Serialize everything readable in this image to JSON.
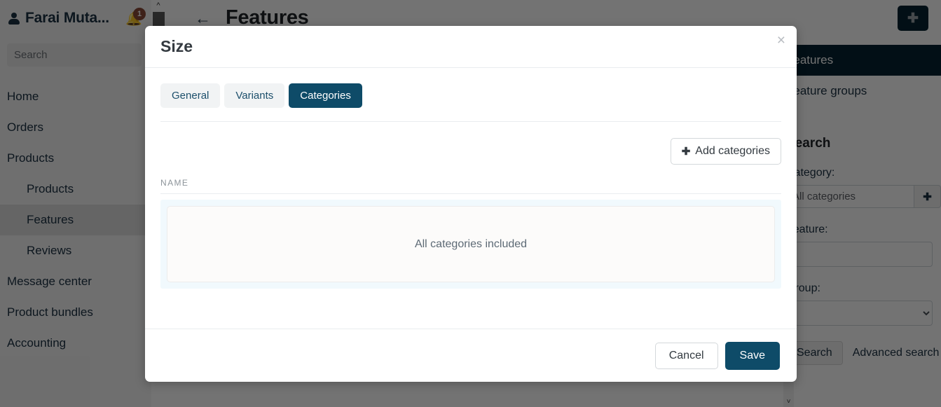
{
  "sidebar": {
    "user": {
      "name": "Farai Muta...",
      "icon": "user-icon"
    },
    "notifications": {
      "icon": "bell-icon",
      "count": "1"
    },
    "search": {
      "placeholder": "Search",
      "value": "",
      "icon": "search-icon"
    },
    "items": [
      {
        "label": "Home",
        "level": 0,
        "active": false
      },
      {
        "label": "Orders",
        "level": 0,
        "active": false
      },
      {
        "label": "Products",
        "level": 0,
        "active": false
      },
      {
        "label": "Products",
        "level": 1,
        "active": false
      },
      {
        "label": "Features",
        "level": 1,
        "active": true
      },
      {
        "label": "Reviews",
        "level": 1,
        "active": false
      },
      {
        "label": "Message center",
        "level": 0,
        "active": false
      },
      {
        "label": "Product bundles",
        "level": 0,
        "active": false
      },
      {
        "label": "Accounting",
        "level": 0,
        "active": false
      }
    ]
  },
  "topbar": {
    "back_icon": "arrow-left-icon",
    "title": "Features",
    "add_button": {
      "label": "+",
      "icon": "plus-icon"
    }
  },
  "right_panel": {
    "nav": [
      {
        "label": "Features",
        "active": true
      },
      {
        "label": "Feature groups",
        "active": false
      }
    ],
    "search_section": {
      "heading": "Search",
      "category_label": "Category:",
      "category_input": {
        "placeholder": "All categories",
        "value": ""
      },
      "category_add_icon": "plus-icon",
      "feature_label": "Feature:",
      "feature_input": {
        "placeholder": "",
        "value": ""
      },
      "group_label": "Group:",
      "group_select": {
        "value": ""
      },
      "search_button": "Search",
      "advanced_link": "Advanced search"
    }
  },
  "modal": {
    "title": "Size",
    "close_icon": "close-icon",
    "tabs": [
      {
        "label": "General",
        "active": false
      },
      {
        "label": "Variants",
        "active": false
      },
      {
        "label": "Categories",
        "active": true
      }
    ],
    "add_categories_button": {
      "label": "Add categories",
      "icon": "plus-icon"
    },
    "table": {
      "columns": [
        "NAME"
      ],
      "empty_message": "All categories included",
      "rows": []
    },
    "footer": {
      "cancel_label": "Cancel",
      "save_label": "Save"
    }
  },
  "colors": {
    "accent": "#0e4b68",
    "dark_navy": "#052331",
    "badge": "#8a4a38",
    "panel_blue": "#f1f9fd"
  }
}
